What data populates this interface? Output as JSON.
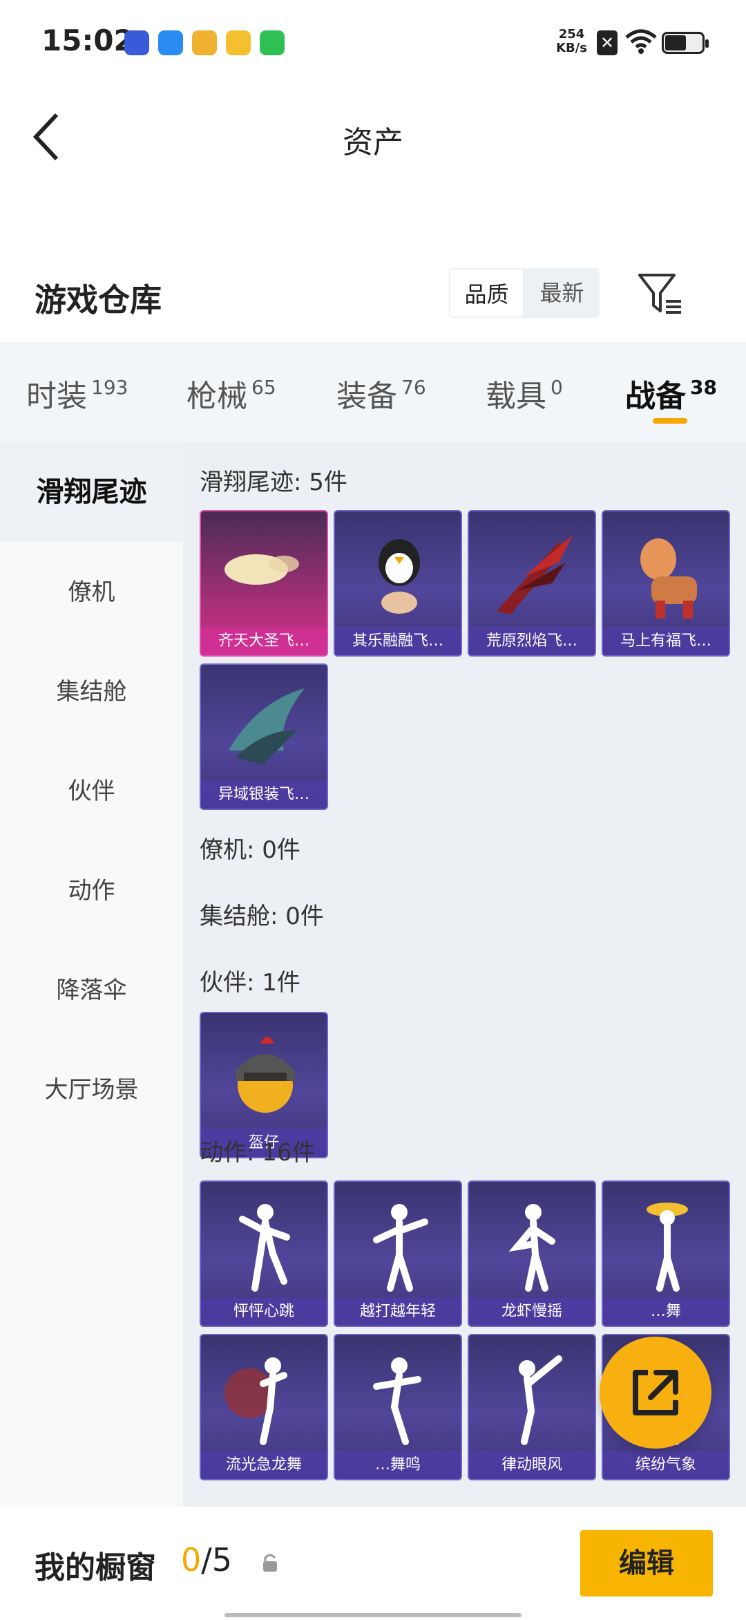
{
  "status_bar": {
    "time": "15:02",
    "net_speed_value": "254",
    "net_speed_unit": "KB/s"
  },
  "header": {
    "title": "资产"
  },
  "warehouse": {
    "title": "游戏仓库",
    "sort_options": [
      "品质",
      "最新"
    ],
    "sort_selected": "品质"
  },
  "tabs": [
    {
      "label": "时装",
      "count": "193"
    },
    {
      "label": "枪械",
      "count": "65"
    },
    {
      "label": "装备",
      "count": "76"
    },
    {
      "label": "载具",
      "count": "0"
    },
    {
      "label": "战备",
      "count": "38",
      "active": true
    }
  ],
  "side_nav": [
    "滑翔尾迹",
    "僚机",
    "集结舱",
    "伙伴",
    "动作",
    "降落伞",
    "大厅场景"
  ],
  "sections": {
    "glide": {
      "title": "滑翔尾迹: 5件",
      "items": [
        "齐天大圣飞…",
        "其乐融融飞…",
        "荒原烈焰飞…",
        "马上有福飞…",
        "异域银装飞…"
      ]
    },
    "wingman": {
      "title": "僚机: 0件"
    },
    "assembly": {
      "title": "集结舱: 0件"
    },
    "partner": {
      "title": "伙伴: 1件",
      "items": [
        "盔仔"
      ]
    },
    "emote": {
      "title": "动作: 16件",
      "items": [
        "怦怦心跳",
        "越打越年轻",
        "龙虾慢摇",
        "…舞",
        "流光急龙舞",
        "…舞鸣",
        "律动眼风",
        "缤纷气象"
      ]
    }
  },
  "showcase": {
    "label": "我的橱窗",
    "current": "0",
    "total": "/5",
    "edit_label": "编辑"
  },
  "colors": {
    "accent": "#f5a800",
    "card_purple": "#51469a",
    "card_pink": "#cf2e8f"
  }
}
